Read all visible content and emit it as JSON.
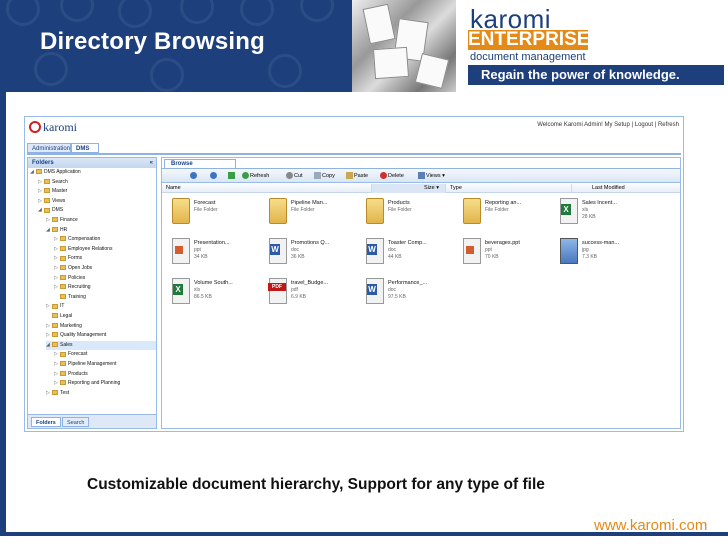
{
  "slide": {
    "title": "Directory Browsing",
    "caption": "Customizable document hierarchy, Support for any type of file",
    "url": "www.karomi.com"
  },
  "brand": {
    "name": "karomi",
    "product": "ENTERPRISE",
    "subtitle": "document management",
    "tagline": "Regain the power of knowledge.",
    "colors": {
      "navy": "#1d3f7c",
      "orange": "#e48a18"
    }
  },
  "app": {
    "logo_text": "karomi",
    "top_links": "Welcome Karomi Admin!  My Setup |  Logout | Refresh",
    "nav_tabs": [
      "Administration",
      "DMS"
    ],
    "folders_panel": {
      "title": "Folders",
      "collapse_icon": "«",
      "tabs": [
        "Folders",
        "Search"
      ],
      "tree": [
        {
          "label": "DMS Application",
          "arrow": "◢"
        },
        {
          "label": "Search",
          "arrow": "▷"
        },
        {
          "label": "Master",
          "arrow": "▷"
        },
        {
          "label": "Views",
          "arrow": "▷"
        },
        {
          "label": "DMS",
          "arrow": "◢"
        },
        {
          "label": "Finance",
          "arrow": "▷"
        },
        {
          "label": "HR",
          "arrow": "◢"
        },
        {
          "label": "Compensation",
          "arrow": "▷"
        },
        {
          "label": "Employee Relations",
          "arrow": "▷"
        },
        {
          "label": "Forms",
          "arrow": "▷"
        },
        {
          "label": "Open Jobs",
          "arrow": "▷"
        },
        {
          "label": "Policies",
          "arrow": "▷"
        },
        {
          "label": "Recruiting",
          "arrow": "▷"
        },
        {
          "label": "Training",
          "arrow": ""
        },
        {
          "label": "IT",
          "arrow": "▷"
        },
        {
          "label": "Legal",
          "arrow": ""
        },
        {
          "label": "Marketing",
          "arrow": "▷"
        },
        {
          "label": "Quality Management",
          "arrow": "▷"
        },
        {
          "label": "Sales",
          "arrow": "◢"
        },
        {
          "label": "Forecast",
          "arrow": "▷"
        },
        {
          "label": "Pipeline Management",
          "arrow": "▷"
        },
        {
          "label": "Products",
          "arrow": "▷"
        },
        {
          "label": "Reporting and Planning",
          "arrow": "▷"
        },
        {
          "label": "Test",
          "arrow": "▷"
        }
      ]
    },
    "browse_panel": {
      "tab": "Browse",
      "toolbar": {
        "refresh": "Refresh",
        "cut": "Cut",
        "copy": "Copy",
        "paste": "Paste",
        "delete": "Delete",
        "views": "Views"
      },
      "columns": {
        "name": "Name",
        "size": "Size ▾",
        "type": "Type",
        "modified": "Last Modified"
      },
      "files": [
        {
          "name": "Forecast",
          "type": "File Folder",
          "size": "",
          "icon": "folder-icon"
        },
        {
          "name": "Pipeline Man...",
          "type": "File Folder",
          "size": "",
          "icon": "folder-icon"
        },
        {
          "name": "Products",
          "type": "File Folder",
          "size": "",
          "icon": "folder-icon"
        },
        {
          "name": "Reporting an...",
          "type": "File Folder",
          "size": "",
          "icon": "folder-icon"
        },
        {
          "name": "Sales Incent...",
          "type": "xls",
          "size": "28 KB",
          "icon": "excel-file-icon"
        },
        {
          "name": "Presentation...",
          "type": "ppt",
          "size": "34 KB",
          "icon": "powerpoint-file-icon"
        },
        {
          "name": "Promotions Q...",
          "type": "doc",
          "size": "36 KB",
          "icon": "word-file-icon"
        },
        {
          "name": "Toaster Comp...",
          "type": "doc",
          "size": "44 KB",
          "icon": "word-file-icon"
        },
        {
          "name": "beverages.ppt",
          "type": "ppt",
          "size": "70 KB",
          "icon": "powerpoint-file-icon"
        },
        {
          "name": "success-man...",
          "type": "jpg",
          "size": "7.3 KB",
          "icon": "image-file-icon"
        },
        {
          "name": "Volume South...",
          "type": "xls",
          "size": "86.5 KB",
          "icon": "excel-file-icon"
        },
        {
          "name": "travel_Budge...",
          "type": "pdf",
          "size": "6.9 KB",
          "icon": "pdf-file-icon"
        },
        {
          "name": "Performance_...",
          "type": "doc",
          "size": "97.5 KB",
          "icon": "word-file-icon"
        }
      ]
    }
  }
}
